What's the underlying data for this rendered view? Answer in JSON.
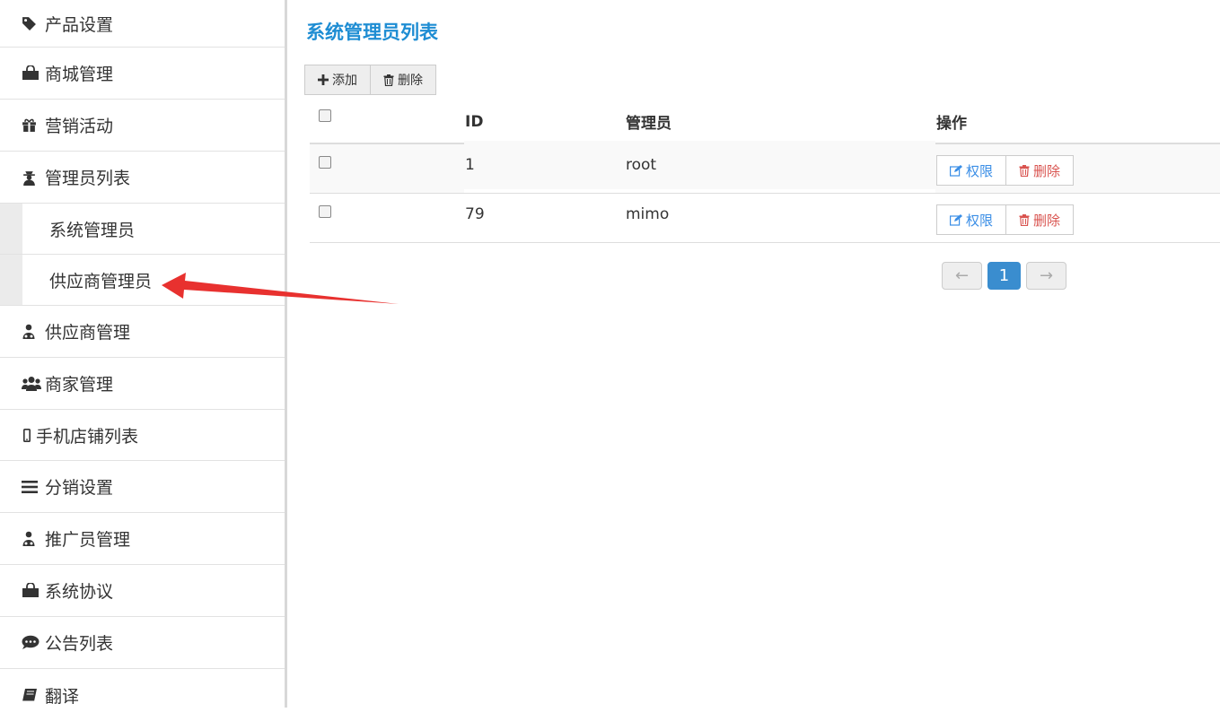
{
  "sidebar": {
    "items": [
      {
        "label": "产品设置",
        "icon": "tag-icon"
      },
      {
        "label": "商城管理",
        "icon": "shopping-bag-icon"
      },
      {
        "label": "营销活动",
        "icon": "gift-icon"
      },
      {
        "label": "管理员列表",
        "icon": "user-secret-icon"
      },
      {
        "label": "供应商管理",
        "icon": "user-md-icon"
      },
      {
        "label": "商家管理",
        "icon": "users-icon"
      },
      {
        "label": "手机店铺列表",
        "icon": "mobile-icon"
      },
      {
        "label": "分销设置",
        "icon": "bars-icon"
      },
      {
        "label": "推广员管理",
        "icon": "user-md-icon"
      },
      {
        "label": "系统协议",
        "icon": "shopping-bag-icon"
      },
      {
        "label": "公告列表",
        "icon": "comment-icon"
      },
      {
        "label": "翻译",
        "icon": "book-icon"
      }
    ],
    "sub_items": [
      {
        "label": "系统管理员"
      },
      {
        "label": "供应商管理员"
      }
    ]
  },
  "main": {
    "title": "系统管理员列表",
    "toolbar": {
      "add_label": "添加",
      "delete_label": "删除"
    },
    "table": {
      "headers": {
        "id": "ID",
        "admin": "管理员",
        "ops": "操作"
      },
      "rows": [
        {
          "id": "1",
          "admin": "root"
        },
        {
          "id": "79",
          "admin": "mimo"
        }
      ],
      "perm_label": "权限",
      "delete_label": "删除"
    },
    "pagination": {
      "prev": "←",
      "current": "1",
      "next": "→"
    }
  },
  "colors": {
    "accent": "#1e8dd3",
    "pagination_active": "#3a8dcf",
    "danger": "#d9534f",
    "annotation_arrow": "#e8312f"
  }
}
